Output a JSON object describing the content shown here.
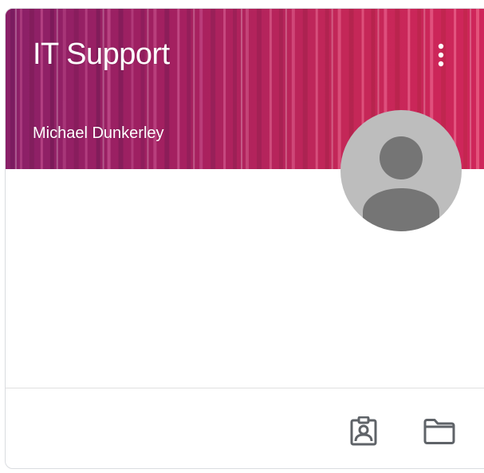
{
  "card": {
    "title": "IT Support",
    "teacher": "Michael Dunkerley"
  },
  "icons": {
    "more": "more-vert-icon",
    "avatar": "person-avatar-icon",
    "work": "assignment-ind-icon",
    "folder": "folder-icon"
  },
  "colors": {
    "banner": "#a01f5c",
    "avatar_bg": "#bdbdbd",
    "avatar_fg": "#757575",
    "icon": "#5f6368"
  }
}
